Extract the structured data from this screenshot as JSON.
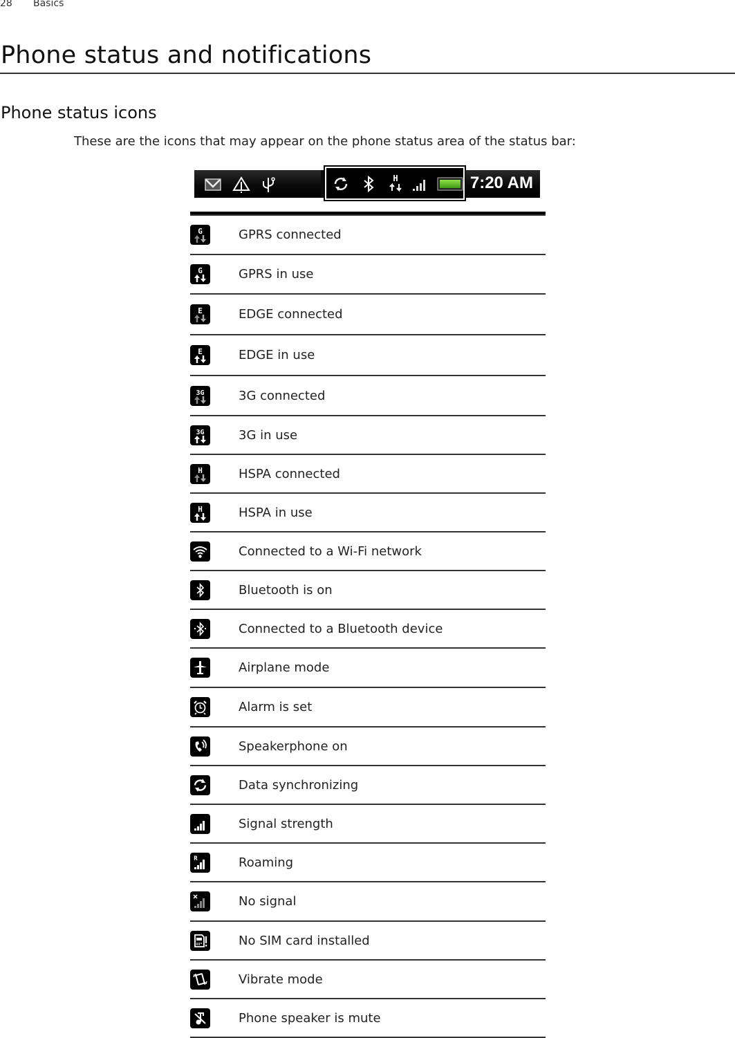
{
  "header": {
    "page_number": "28",
    "section": "Basics"
  },
  "title": "Phone status and notifications",
  "subtitle": "Phone status icons",
  "intro": "These are the icons that may appear on the phone status area of the status bar:",
  "status_bar": {
    "left_icons": [
      "gmail-icon",
      "warning-icon",
      "usb-icon"
    ],
    "highlighted_icons": [
      "sync-icon",
      "bluetooth-icon",
      "hspa-icon",
      "signal-icon",
      "battery-icon"
    ],
    "time": "7:20 AM",
    "battery_level": 1.0,
    "battery_color": "#5cc025"
  },
  "rows": [
    {
      "icon": "gprs-connected-icon",
      "label": "GPRS connected"
    },
    {
      "icon": "gprs-in-use-icon",
      "label": "GPRS in use"
    },
    {
      "icon": "edge-connected-icon",
      "label": "EDGE connected"
    },
    {
      "icon": "edge-in-use-icon",
      "label": "EDGE in use"
    },
    {
      "icon": "3g-connected-icon",
      "label": "3G connected"
    },
    {
      "icon": "3g-in-use-icon",
      "label": "3G in use"
    },
    {
      "icon": "hspa-connected-icon",
      "label": "HSPA connected"
    },
    {
      "icon": "hspa-in-use-icon",
      "label": "HSPA in use"
    },
    {
      "icon": "wifi-icon",
      "label": "Connected to a Wi-Fi network"
    },
    {
      "icon": "bluetooth-icon",
      "label": "Bluetooth is on"
    },
    {
      "icon": "bluetooth-connected-icon",
      "label": "Connected to a Bluetooth device"
    },
    {
      "icon": "airplane-icon",
      "label": "Airplane mode"
    },
    {
      "icon": "alarm-icon",
      "label": "Alarm is set"
    },
    {
      "icon": "speakerphone-icon",
      "label": "Speakerphone on"
    },
    {
      "icon": "sync-icon",
      "label": "Data synchronizing"
    },
    {
      "icon": "signal-icon",
      "label": "Signal strength"
    },
    {
      "icon": "roaming-icon",
      "label": "Roaming"
    },
    {
      "icon": "no-signal-icon",
      "label": "No signal"
    },
    {
      "icon": "no-sim-icon",
      "label": "No SIM card installed"
    },
    {
      "icon": "vibrate-icon",
      "label": "Vibrate mode"
    },
    {
      "icon": "speaker-mute-icon",
      "label": "Phone speaker is mute"
    }
  ]
}
